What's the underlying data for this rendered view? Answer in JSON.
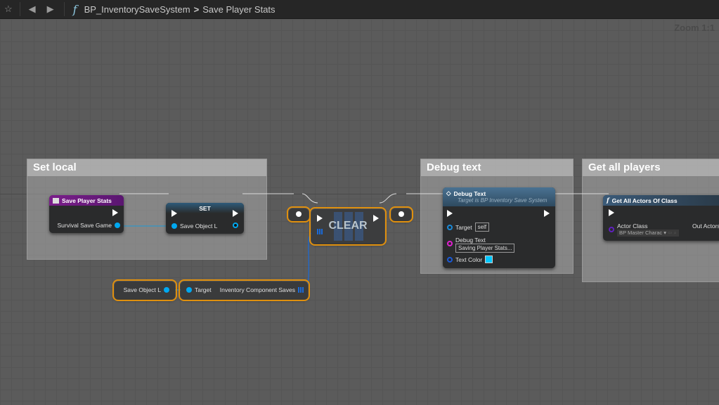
{
  "toolbar": {
    "blueprint": "BP_InventorySaveSystem",
    "separator": ">",
    "function": "Save Player Stats",
    "zoom": "Zoom 1:1"
  },
  "comments": {
    "set_local": "Set local",
    "debug_text": "Debug text",
    "get_all_players": "Get all players"
  },
  "nodes": {
    "save_player_stats": {
      "title": "Save Player Stats",
      "out_pin": "Survival Save Game"
    },
    "set": {
      "title": "SET",
      "pin": "Save Object L"
    },
    "clear": {
      "title": "CLEAR"
    },
    "debug_text": {
      "title": "Debug Text",
      "subtitle": "Target is BP Inventory Save System",
      "target": "Target",
      "target_value": "self",
      "debug_text": "Debug Text",
      "debug_text_value": "Saving Player Stats...",
      "text_color": "Text Color",
      "text_color_value": "#00c8ff"
    },
    "get_all_actors": {
      "title": "Get All Actors Of Class",
      "actor_class": "Actor Class",
      "actor_class_value": "BP Master Charac",
      "out_actors": "Out Actors"
    },
    "save_object_getter": {
      "label": "Save Object L"
    },
    "inventory_getter": {
      "target": "Target",
      "output": "Inventory Component Saves"
    }
  },
  "colors": {
    "accent": "#e0900e",
    "object_pin": "#00a8f0",
    "string_pin": "#e020d0",
    "class_pin": "#6020c0"
  }
}
